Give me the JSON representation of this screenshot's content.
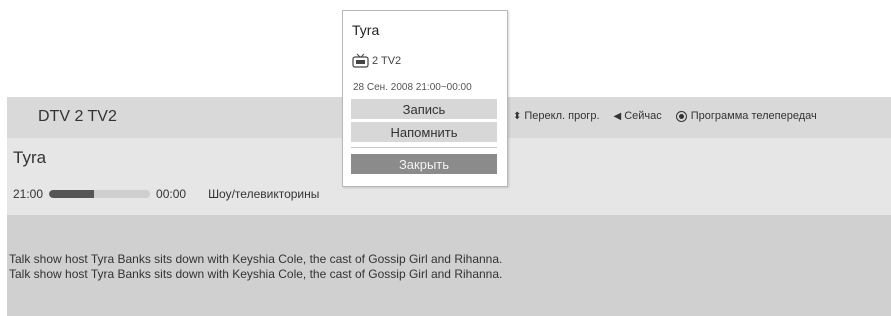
{
  "info": {
    "channel": "DTV 2  TV2",
    "hints": [
      {
        "icon": "up-down-icon",
        "glyph": "⬍",
        "label": "Перекл. прогр."
      },
      {
        "icon": "left-arrow-icon",
        "glyph": "◀",
        "label": "Сейчас"
      },
      {
        "icon": "radio-select-icon",
        "glyph": "",
        "label": "Программа телепередач"
      }
    ],
    "program_title": "Tyra",
    "start_time": "21:00",
    "end_time": "00:00",
    "progress_percent": 45,
    "genre": "Шоу/телевикторины",
    "description_lines": [
      "Talk show host Tyra Banks sits down with Keyshia Cole, the cast of Gossip Girl and Rihanna.",
      "Talk show host Tyra Banks sits down with Keyshia Cole, the cast of Gossip Girl and Rihanna."
    ]
  },
  "popup": {
    "title": "Tyra",
    "channel": "2 TV2",
    "datetime": "28 Сен. 2008 21:00~00:00",
    "record_label": "Запись",
    "remind_label": "Напомнить",
    "close_label": "Закрыть"
  }
}
